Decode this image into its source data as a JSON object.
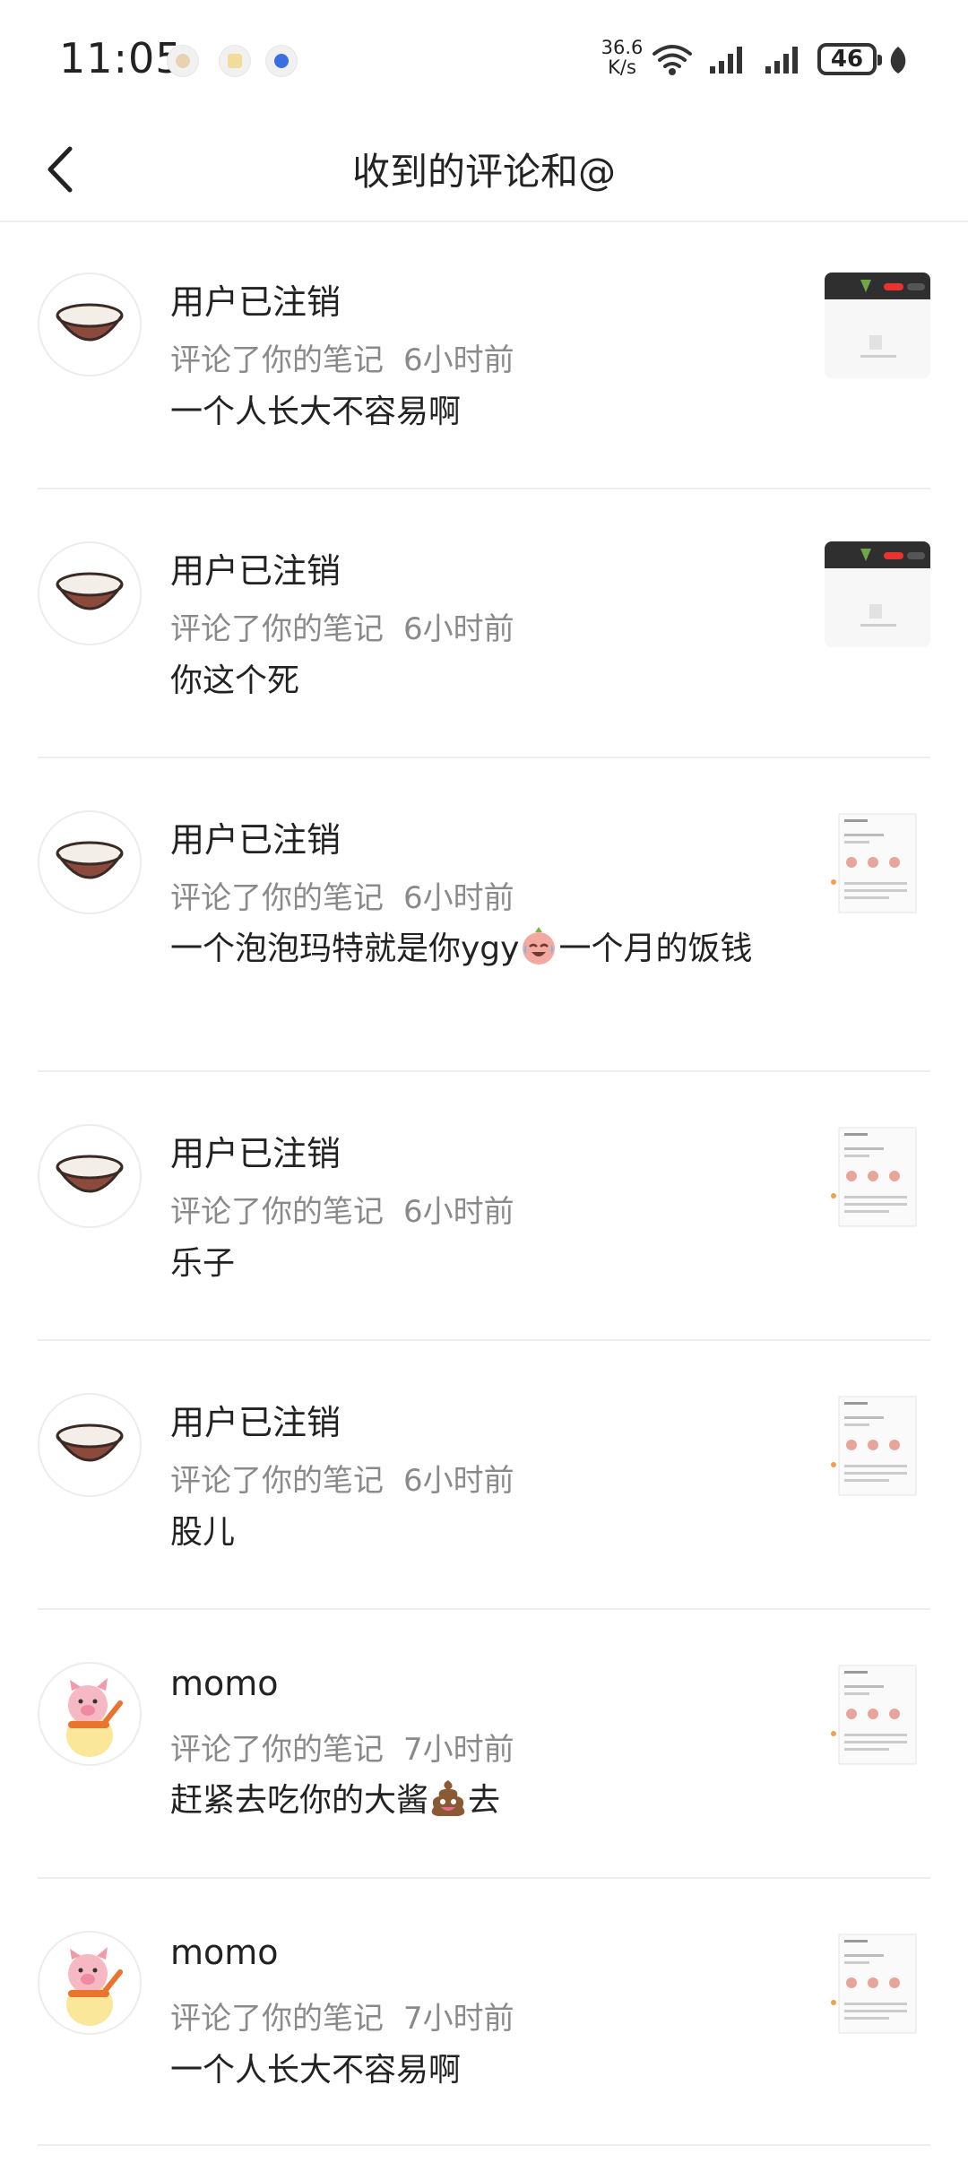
{
  "status_bar": {
    "time": "11:05",
    "net_speed_value": "36.6",
    "net_speed_unit": "K/s",
    "battery": "46",
    "icons": [
      "wifi-icon",
      "signal-icon",
      "signal-icon",
      "leaf-icon"
    ]
  },
  "header": {
    "title": "收到的评论和@",
    "back_icon": "chevron-left-icon"
  },
  "comments": [
    {
      "username": "用户已注销",
      "action": "评论了你的笔记",
      "time": "6小时前",
      "text": "一个人长大不容易啊",
      "avatar": "coconut",
      "thumb": "dark"
    },
    {
      "username": "用户已注销",
      "action": "评论了你的笔记",
      "time": "6小时前",
      "text": "你这个死",
      "avatar": "coconut",
      "thumb": "dark"
    },
    {
      "username": "用户已注销",
      "action": "评论了你的笔记",
      "time": "6小时前",
      "text_before": "一个泡泡玛特就是你ygy",
      "text_emoji": "crying-laughing-emoji",
      "text_after": "一个月的饭钱",
      "avatar": "coconut",
      "thumb": "light"
    },
    {
      "username": "用户已注销",
      "action": "评论了你的笔记",
      "time": "6小时前",
      "text": "乐子",
      "avatar": "coconut",
      "thumb": "light"
    },
    {
      "username": "用户已注销",
      "action": "评论了你的笔记",
      "time": "6小时前",
      "text": "股儿",
      "avatar": "coconut",
      "thumb": "light"
    },
    {
      "username": "momo",
      "action": "评论了你的笔记",
      "time": "7小时前",
      "text_before": "赶紧去吃你的大酱",
      "text_emoji": "poop-emoji",
      "text_after": "去",
      "avatar": "pig",
      "thumb": "light"
    },
    {
      "username": "momo",
      "action": "评论了你的笔记",
      "time": "7小时前",
      "text": "一个人长大不容易啊",
      "avatar": "pig",
      "thumb": "light"
    }
  ]
}
